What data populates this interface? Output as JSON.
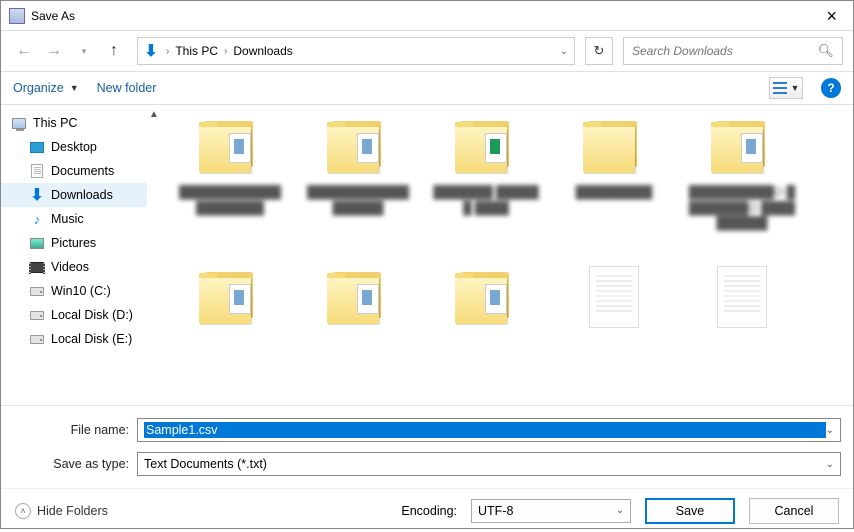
{
  "title": "Save As",
  "nav": {
    "breadcrumb_root": "This PC",
    "breadcrumb_current": "Downloads",
    "search_placeholder": "Search Downloads"
  },
  "toolbar": {
    "organize": "Organize",
    "newfolder": "New folder"
  },
  "tree": {
    "thispc": "This PC",
    "desktop": "Desktop",
    "documents": "Documents",
    "downloads": "Downloads",
    "music": "Music",
    "pictures": "Pictures",
    "videos": "Videos",
    "win10c": "Win10 (C:)",
    "locald": "Local Disk (D:)",
    "locale": "Local Disk (E:)"
  },
  "items": [
    {
      "type": "folder",
      "name": "████████████ ████████"
    },
    {
      "type": "folder",
      "name": "████████████ ██████"
    },
    {
      "type": "folder-green",
      "name": "███████ ██████ ████"
    },
    {
      "type": "folder",
      "name": "█████████"
    },
    {
      "type": "folder",
      "name": "██████████O ████████O ██████████"
    },
    {
      "type": "folder",
      "name": ""
    },
    {
      "type": "folder",
      "name": ""
    },
    {
      "type": "folder",
      "name": ""
    },
    {
      "type": "file",
      "name": ""
    },
    {
      "type": "file",
      "name": ""
    }
  ],
  "form": {
    "filename_label": "File name:",
    "filename_value": "Sample1.csv",
    "savetype_label": "Save as type:",
    "savetype_value": "Text Documents (*.txt)"
  },
  "actions": {
    "hide_folders": "Hide Folders",
    "encoding_label": "Encoding:",
    "encoding_value": "UTF-8",
    "save": "Save",
    "cancel": "Cancel"
  }
}
